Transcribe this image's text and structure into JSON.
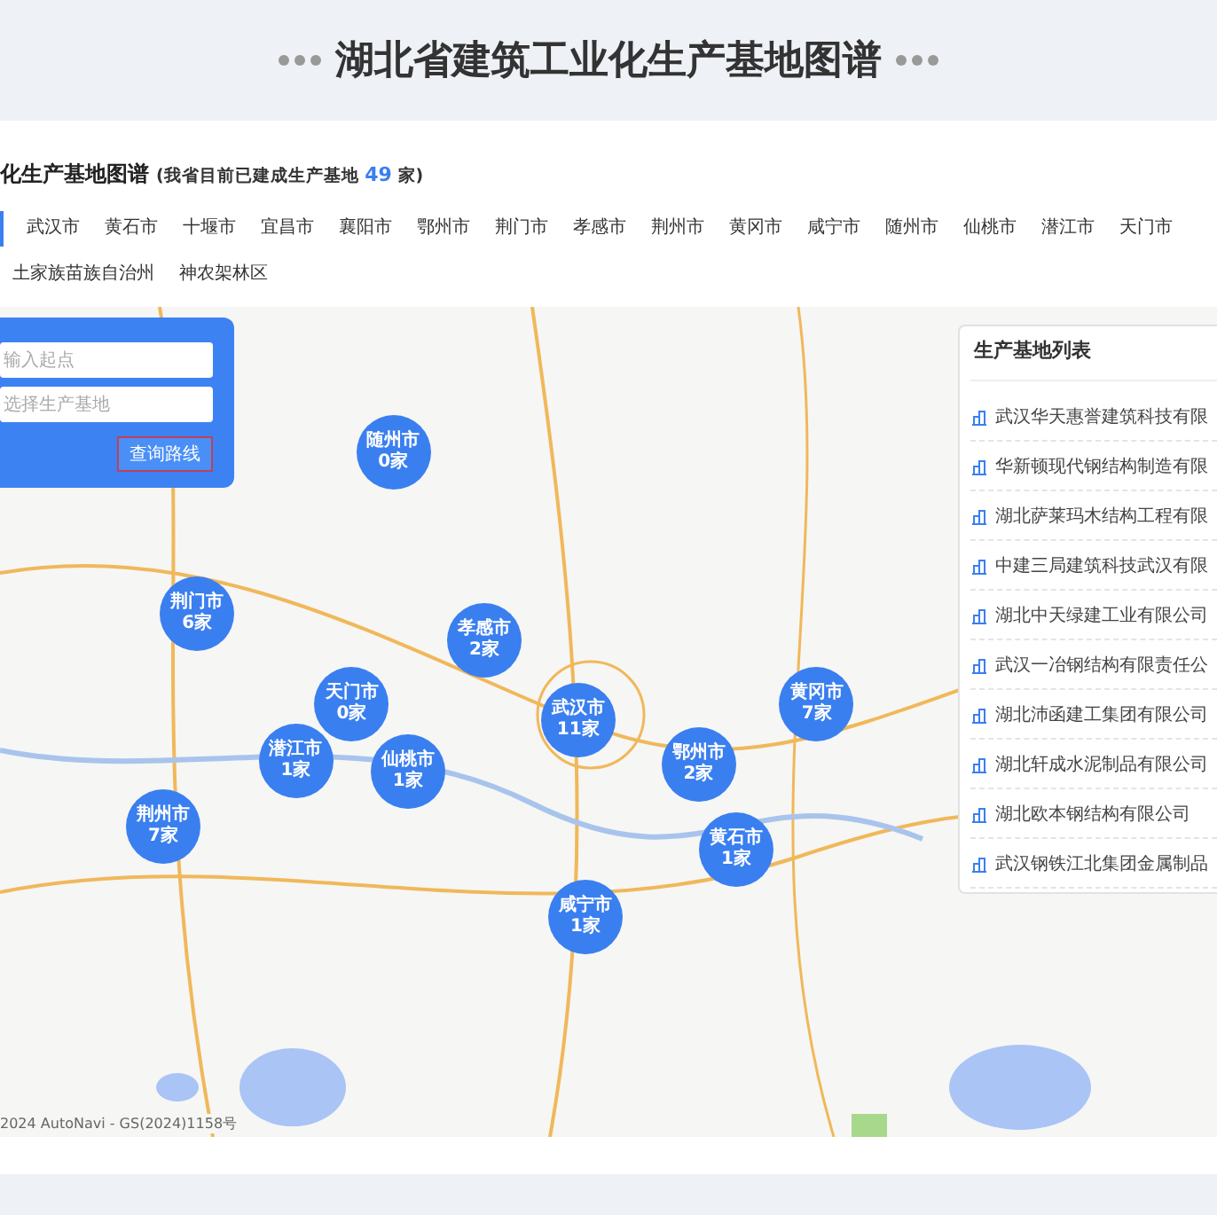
{
  "header": {
    "title": "湖北省建筑工业化生产基地图谱"
  },
  "subtitle": {
    "title": "化生产基地图谱",
    "note_before": "(我省目前已建成生产基地",
    "count": "49",
    "note_after": "家)"
  },
  "tabs": [
    {
      "label": "武汉市",
      "selected": false
    },
    {
      "label": "黄石市",
      "selected": false
    },
    {
      "label": "十堰市",
      "selected": false
    },
    {
      "label": "宜昌市",
      "selected": false
    },
    {
      "label": "襄阳市",
      "selected": false
    },
    {
      "label": "鄂州市",
      "selected": false
    },
    {
      "label": "荆门市",
      "selected": false
    },
    {
      "label": "孝感市",
      "selected": false
    },
    {
      "label": "荆州市",
      "selected": false
    },
    {
      "label": "黄冈市",
      "selected": false
    },
    {
      "label": "咸宁市",
      "selected": false
    },
    {
      "label": "随州市",
      "selected": false
    },
    {
      "label": "仙桃市",
      "selected": false
    },
    {
      "label": "潜江市",
      "selected": false
    },
    {
      "label": "天门市",
      "selected": false
    },
    {
      "label": "土家族苗族自治州",
      "selected": false
    },
    {
      "label": "神农架林区",
      "selected": false
    }
  ],
  "route_panel": {
    "start_placeholder": "输入起点",
    "base_placeholder": "选择生产基地",
    "button": "查询路线"
  },
  "markers": [
    {
      "city": "随州市",
      "count": "0家"
    },
    {
      "city": "荆门市",
      "count": "6家"
    },
    {
      "city": "孝感市",
      "count": "2家"
    },
    {
      "city": "天门市",
      "count": "0家"
    },
    {
      "city": "潜江市",
      "count": "1家"
    },
    {
      "city": "仙桃市",
      "count": "1家"
    },
    {
      "city": "武汉市",
      "count": "11家"
    },
    {
      "city": "黄冈市",
      "count": "7家"
    },
    {
      "city": "鄂州市",
      "count": "2家"
    },
    {
      "city": "黄石市",
      "count": "1家"
    },
    {
      "city": "荆州市",
      "count": "7家"
    },
    {
      "city": "咸宁市",
      "count": "1家"
    }
  ],
  "base_list": {
    "title": "生产基地列表",
    "items": [
      "武汉华天惠誉建筑科技有限",
      "华新顿现代钢结构制造有限",
      "湖北萨莱玛木结构工程有限",
      "中建三局建筑科技武汉有限",
      "湖北中天绿建工业有限公司",
      "武汉一冶钢结构有限责任公",
      "湖北沛函建工集团有限公司",
      "湖北轩成水泥制品有限公司",
      "湖北欧本钢结构有限公司",
      "武汉钢铁江北集团金属制品"
    ]
  },
  "map_attribution": "2024 AutoNavi - GS(2024)1158号"
}
